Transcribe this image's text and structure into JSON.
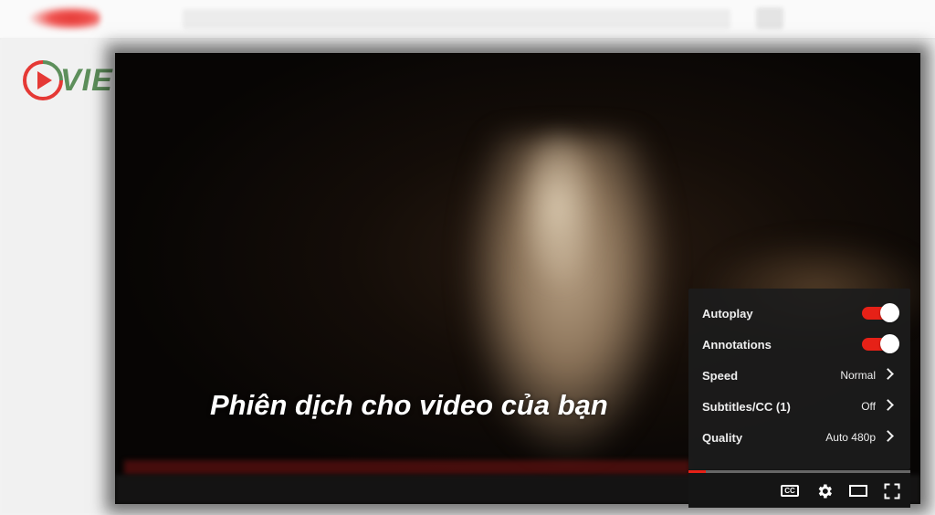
{
  "brand": {
    "watermark": "VIEW"
  },
  "video": {
    "subtitle": "Phiên dịch cho video của bạn"
  },
  "settings": {
    "items": [
      {
        "label": "Autoplay",
        "type": "toggle",
        "on": true
      },
      {
        "label": "Annotations",
        "type": "toggle",
        "on": true
      },
      {
        "label": "Speed",
        "type": "submenu",
        "value": "Normal"
      },
      {
        "label": "Subtitles/CC (1)",
        "type": "submenu",
        "value": "Off"
      },
      {
        "label": "Quality",
        "type": "submenu",
        "value": "Auto 480p"
      }
    ]
  },
  "player": {
    "progress_fraction": 0.08,
    "controls": [
      "cc-icon",
      "gear-icon",
      "theater-icon",
      "fullscreen-icon"
    ],
    "cc_text": "CC"
  },
  "colors": {
    "accent": "#e62117",
    "panel": "#1c1c1c",
    "watermark": "#5d8f5b"
  }
}
